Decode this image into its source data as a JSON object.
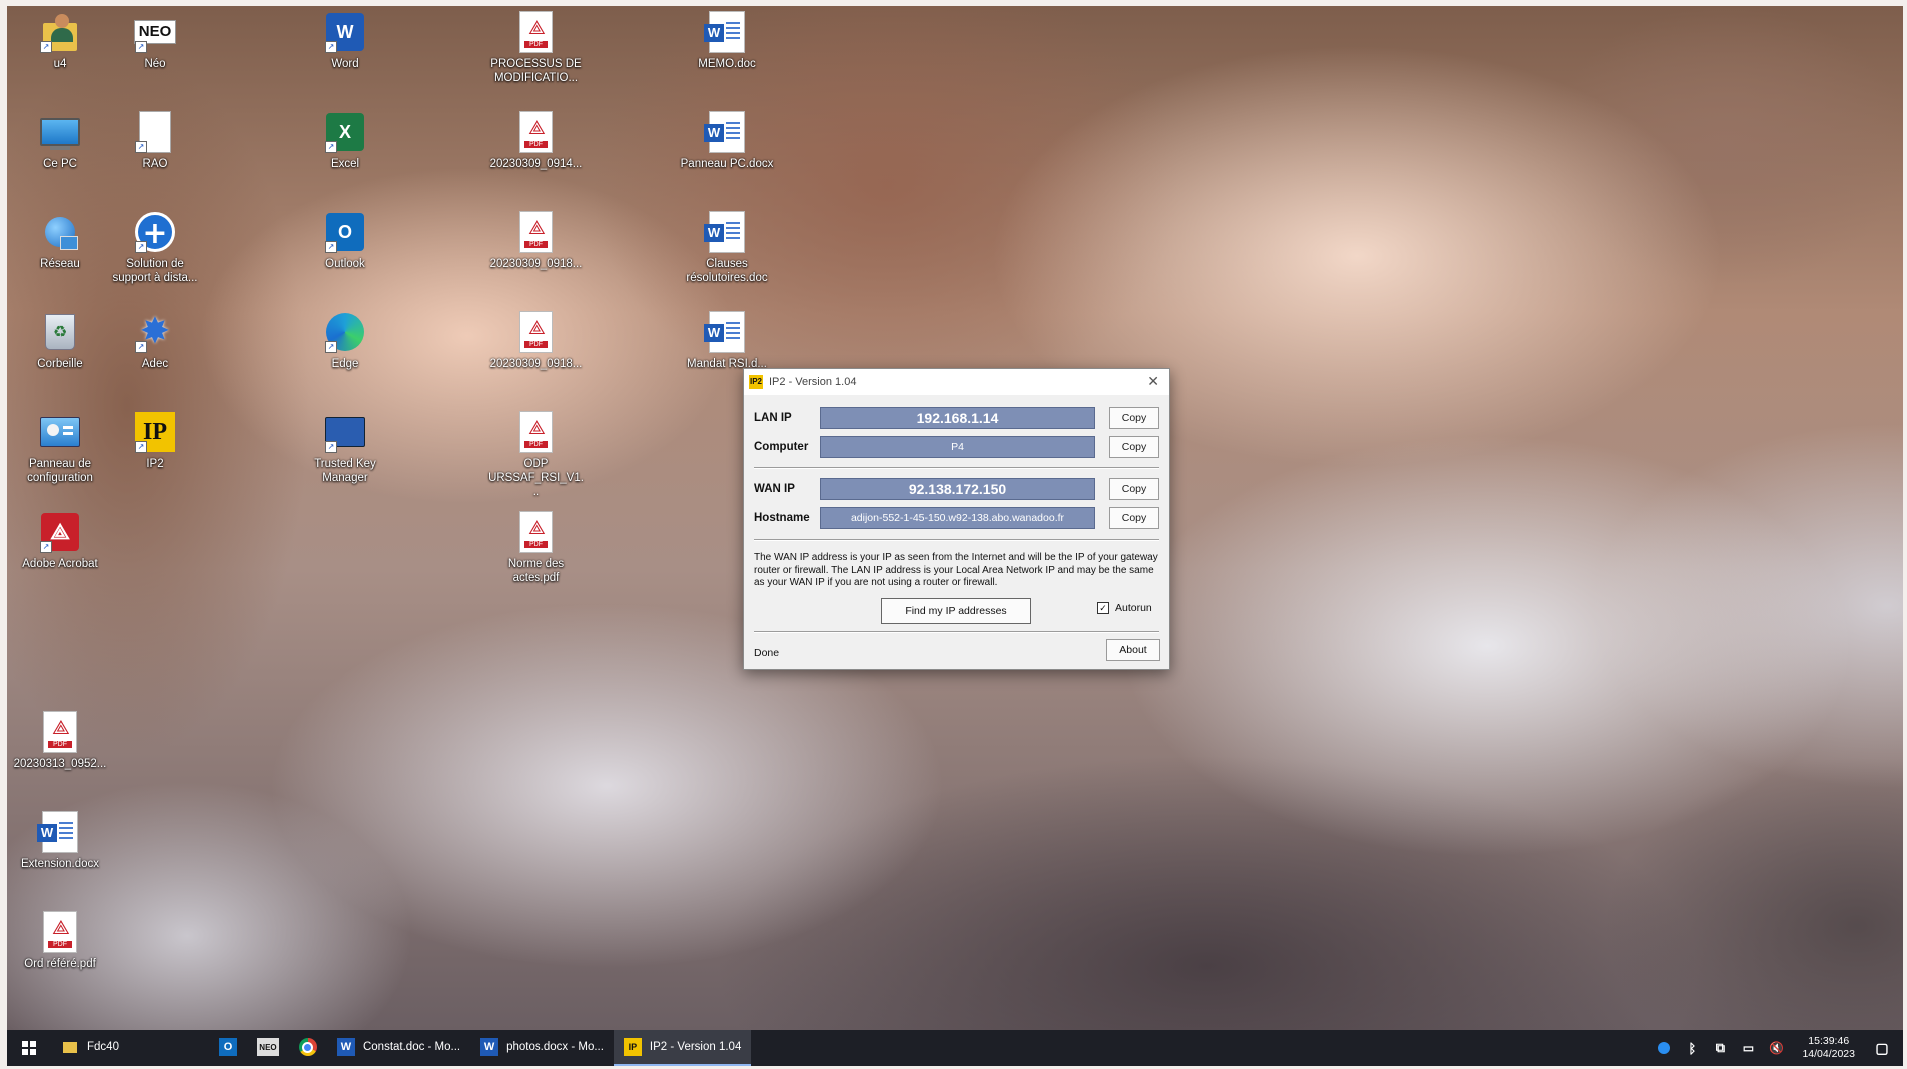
{
  "desktop": {
    "icons": [
      {
        "id": "user",
        "label": "u4",
        "icon": "user-folder-icon"
      },
      {
        "id": "pc",
        "label": "Ce PC",
        "icon": "computer-icon"
      },
      {
        "id": "reseau",
        "label": "Réseau",
        "icon": "network-icon"
      },
      {
        "id": "corbeille",
        "label": "Corbeille",
        "icon": "recycle-bin-icon"
      },
      {
        "id": "panneau",
        "label": "Panneau de configuration",
        "icon": "control-panel-icon"
      },
      {
        "id": "acrobat",
        "label": "Adobe Acrobat",
        "icon": "adobe-acrobat-icon"
      },
      {
        "id": "pdf-2023",
        "label": "20230313_0952...",
        "icon": "pdf-icon"
      },
      {
        "id": "extension",
        "label": "Extension.docx",
        "icon": "word-doc-icon"
      },
      {
        "id": "ord",
        "label": "Ord référé.pdf",
        "icon": "pdf-icon"
      },
      {
        "id": "neo",
        "label": "Néo",
        "icon": "neo-icon"
      },
      {
        "id": "rao",
        "label": "RAO",
        "icon": "blank-file-icon"
      },
      {
        "id": "support",
        "label": "Solution de support à dista...",
        "icon": "remote-support-icon"
      },
      {
        "id": "adec",
        "label": "Adec",
        "icon": "adec-icon"
      },
      {
        "id": "ip2",
        "label": "IP2",
        "icon": "ip2-icon"
      },
      {
        "id": "word",
        "label": "Word",
        "icon": "word-app-icon"
      },
      {
        "id": "excel",
        "label": "Excel",
        "icon": "excel-app-icon"
      },
      {
        "id": "outlook",
        "label": "Outlook",
        "icon": "outlook-app-icon"
      },
      {
        "id": "edge",
        "label": "Edge",
        "icon": "edge-icon"
      },
      {
        "id": "trusted",
        "label": "Trusted Key Manager",
        "icon": "trusted-key-manager-icon"
      },
      {
        "id": "processus",
        "label": "PROCESSUS DE MODIFICATIO...",
        "icon": "pdf-icon"
      },
      {
        "id": "pdf-0914",
        "label": "20230309_0914...",
        "icon": "pdf-icon"
      },
      {
        "id": "pdf-0918a",
        "label": "20230309_0918...",
        "icon": "pdf-icon"
      },
      {
        "id": "pdf-0918b",
        "label": "20230309_0918...",
        "icon": "pdf-icon"
      },
      {
        "id": "odp",
        "label": "ODP URSSAF_RSI_V1...",
        "icon": "pdf-icon"
      },
      {
        "id": "norme",
        "label": "Norme des actes.pdf",
        "icon": "pdf-icon"
      },
      {
        "id": "memo",
        "label": "MEMO.doc",
        "icon": "word-doc-icon"
      },
      {
        "id": "panneau-doc",
        "label": "Panneau PC.docx",
        "icon": "word-doc-icon"
      },
      {
        "id": "clauses",
        "label": "Clauses résolutoires.doc",
        "icon": "word-doc-icon"
      },
      {
        "id": "mandat",
        "label": "Mandat RSI.d...",
        "icon": "word-doc-icon"
      }
    ]
  },
  "dialog": {
    "title": "IP2 - Version 1.04",
    "app_icon_text": "IP2",
    "close_glyph": "✕",
    "rows": [
      {
        "label": "LAN IP",
        "value": "192.168.1.14",
        "copy": "Copy"
      },
      {
        "label": "Computer",
        "value": "P4",
        "copy": "Copy"
      },
      {
        "label": "WAN IP",
        "value": "92.138.172.150",
        "copy": "Copy"
      },
      {
        "label": "Hostname",
        "value": "adijon-552-1-45-150.w92-138.abo.wanadoo.fr",
        "copy": "Copy"
      }
    ],
    "description": "The WAN IP address is your IP as seen from the Internet and will be the IP of your gateway router or firewall. The LAN IP address is your Local Area Network IP and may be the same as your WAN IP if you are not using a router or firewall.",
    "find_button": "Find my IP addresses",
    "autorun_label": "Autorun",
    "autorun_checked": true,
    "status": "Done",
    "about_button": "About"
  },
  "taskbar": {
    "start_icon": "windows-start-icon",
    "items": [
      {
        "icon": "folder-icon",
        "label": "Fdc40",
        "active": false
      },
      {
        "icon": "outlook-icon",
        "label": "",
        "active": false
      },
      {
        "icon": "neo-icon",
        "label": "",
        "active": false
      },
      {
        "icon": "chrome-icon",
        "label": "",
        "active": false
      },
      {
        "icon": "word-icon",
        "label": "Constat.doc - Mo...",
        "active": false
      },
      {
        "icon": "word-icon",
        "label": "photos.docx - Mo...",
        "active": false
      },
      {
        "icon": "ip2-icon",
        "label": "IP2 - Version 1.04",
        "active": true
      }
    ],
    "clock_time": "15:39:46",
    "clock_date": "14/04/2023"
  },
  "colors": {
    "ip_field": "#7e8fb5",
    "taskbar": "#1d1f26",
    "pdf_red": "#c8202a",
    "word_blue": "#1f5ab5",
    "excel_green": "#1d7a45",
    "outlook_blue": "#0f6cbd"
  }
}
